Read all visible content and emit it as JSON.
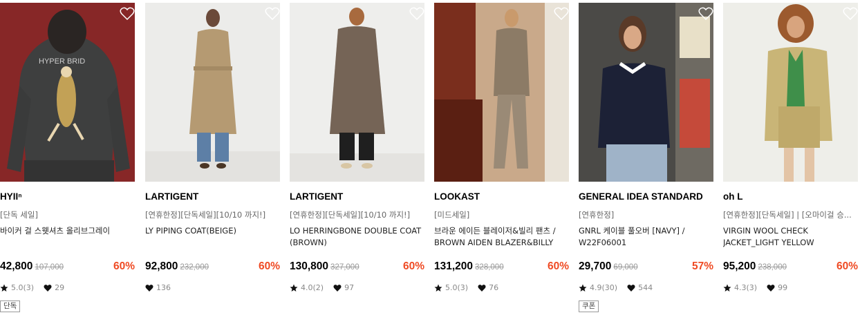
{
  "products": [
    {
      "brand": "HYIIⁿ",
      "tag": "[단독 세일]",
      "name": "바이커 걸 스웻셔츠 올리브그레이",
      "price": "42,800",
      "original_price": "107,000",
      "discount": "60%",
      "rating": "5.0(3)",
      "likes": "29",
      "badge": "단독",
      "image_text": "HYPER BRID"
    },
    {
      "brand": "LARTIGENT",
      "tag": "[연휴한정][단독세일][10/10 까지!]",
      "name": "LY PIPING COAT(BEIGE)",
      "price": "92,800",
      "original_price": "232,000",
      "discount": "60%",
      "rating": "",
      "likes": "136",
      "badge": ""
    },
    {
      "brand": "LARTIGENT",
      "tag": "[연휴한정][단독세일][10/10 까지!]",
      "name": "LO HERRINGBONE DOUBLE COAT (BROWN)",
      "price": "130,800",
      "original_price": "327,000",
      "discount": "60%",
      "rating": "4.0(2)",
      "likes": "97",
      "badge": ""
    },
    {
      "brand": "LOOKAST",
      "tag": "[미드세일]",
      "name": "브라운 에이든 블레이저&빌리 팬츠 / BROWN AIDEN BLAZER&BILLY P...",
      "price": "131,200",
      "original_price": "328,000",
      "discount": "60%",
      "rating": "5.0(3)",
      "likes": "76",
      "badge": ""
    },
    {
      "brand": "GENERAL IDEA STANDARD",
      "tag": "[연휴한정]",
      "name": "GNRL 케이블 풀오버 [NAVY] / W22F06001",
      "price": "29,700",
      "original_price": "69,000",
      "discount": "57%",
      "rating": "4.9(30)",
      "likes": "544",
      "badge": "쿠폰"
    },
    {
      "brand": "oh L",
      "tag": "[연휴한정][단독세일] | [오마이걸 승...",
      "name": "VIRGIN WOOL CHECK JACKET_LIGHT YELLOW",
      "price": "95,200",
      "original_price": "238,000",
      "discount": "60%",
      "rating": "4.3(3)",
      "likes": "99",
      "badge": ""
    }
  ],
  "colors": {
    "discount": "#ef4a23",
    "muted": "#888888"
  },
  "icons": {
    "wishlist": "heart-outline-icon",
    "rating": "star-icon",
    "likes": "heart-filled-icon"
  }
}
